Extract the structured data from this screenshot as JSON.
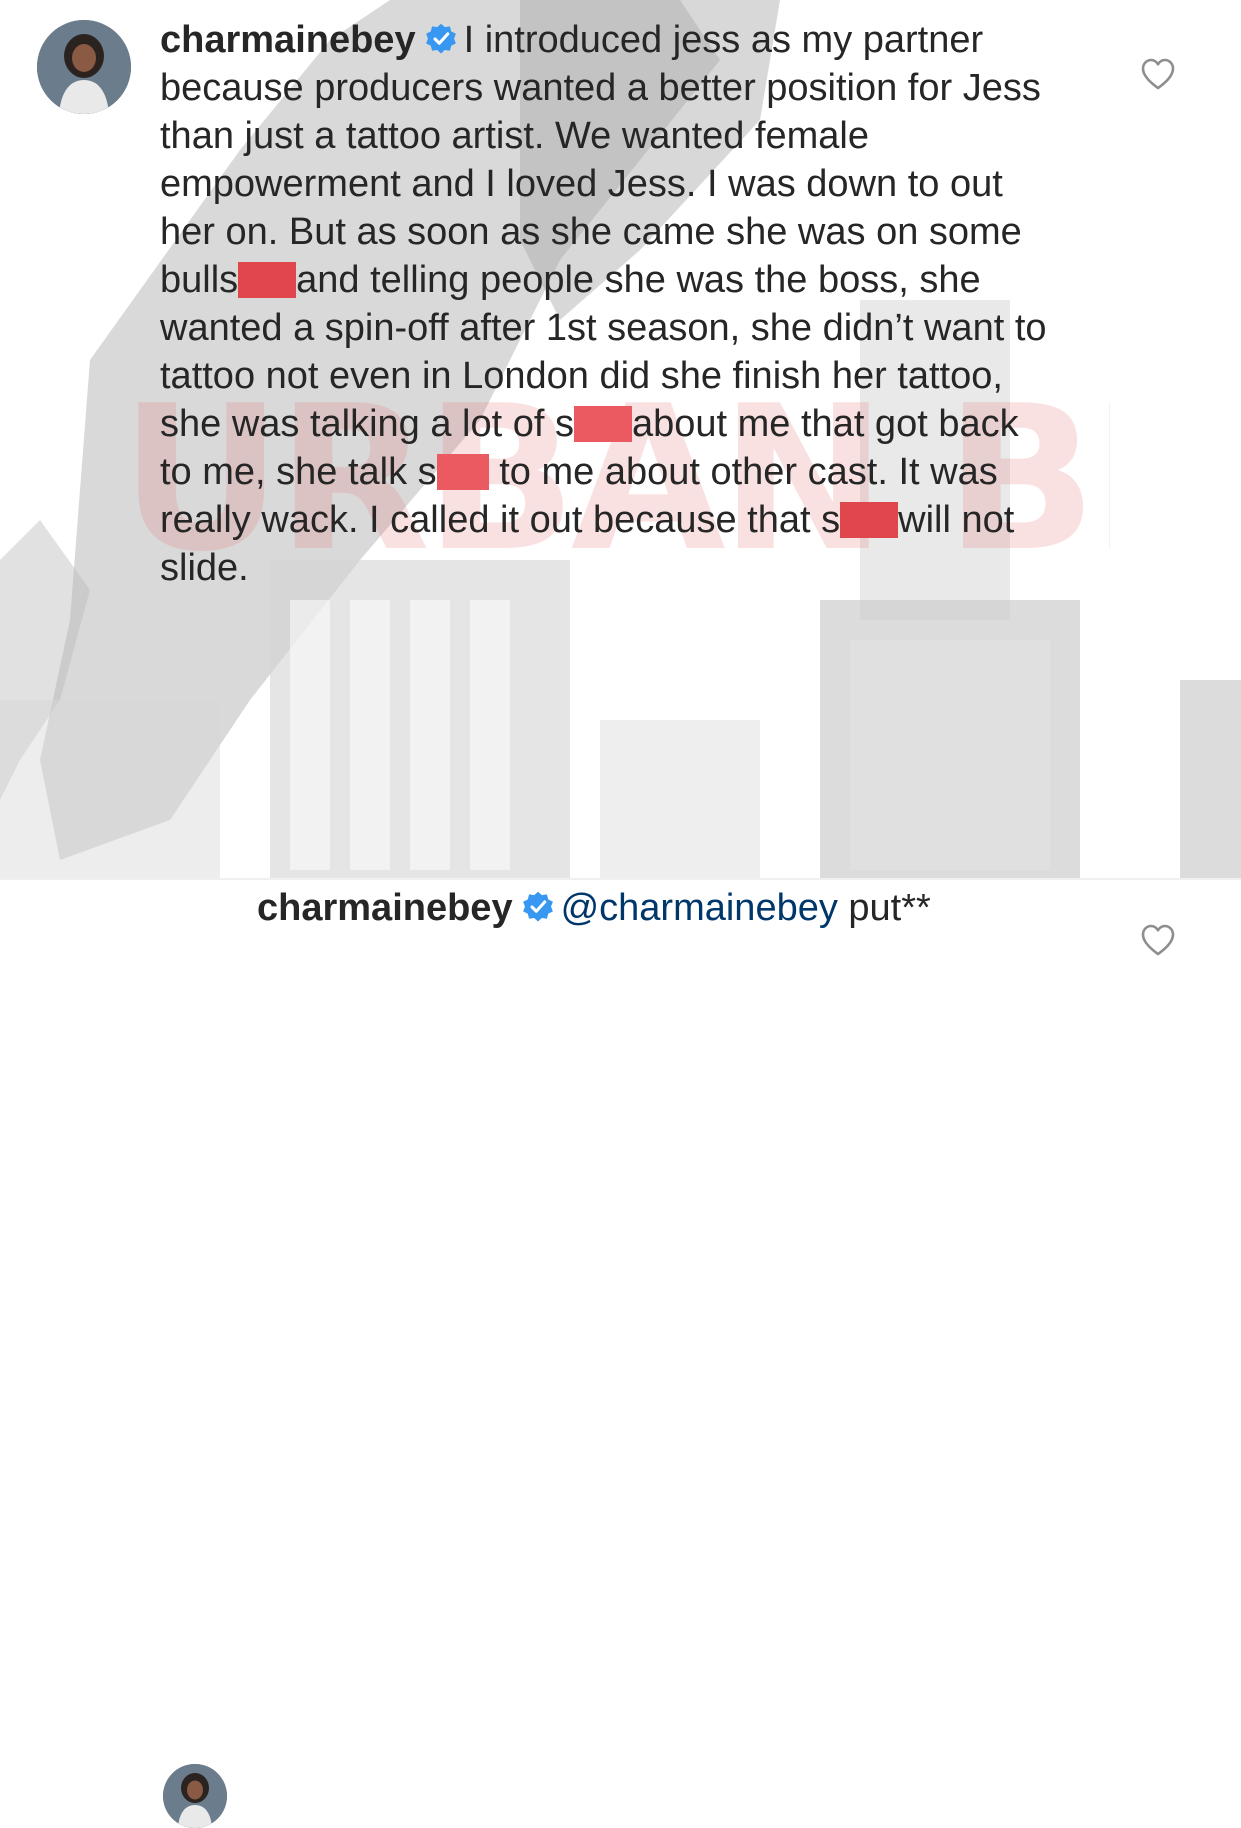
{
  "watermark": {
    "text": "URBAN BELLE"
  },
  "comments": [
    {
      "username": "charmainebey",
      "verified": true,
      "segments": [
        "I introduced jess as my partner because producers wanted a better position for Jess than just a tattoo artist. We wanted female empowerment and I loved Jess. I was down to out her on. But as soon as she came she was on some bulls",
        "and telling people she was the boss, she wanted a spin-off after 1st season, she didn’t want to tattoo not even in London did she finish her tattoo, she was talking a lot of s",
        "about me that got back to me, she talk s",
        " to me about other cast. It was really wack. I called it out because that s",
        "will not slide."
      ],
      "liked": false
    },
    {
      "username": "charmainebey",
      "verified": true,
      "mention": "@charmainebey",
      "text": " put**",
      "liked": false
    }
  ],
  "icons": {
    "verified": "verified-badge-icon",
    "like": "heart-outline-icon"
  },
  "colors": {
    "text": "#262626",
    "mention": "#00376b",
    "verified": "#3897f0",
    "redaction": "#e0474d",
    "watermark": "#e87878"
  }
}
